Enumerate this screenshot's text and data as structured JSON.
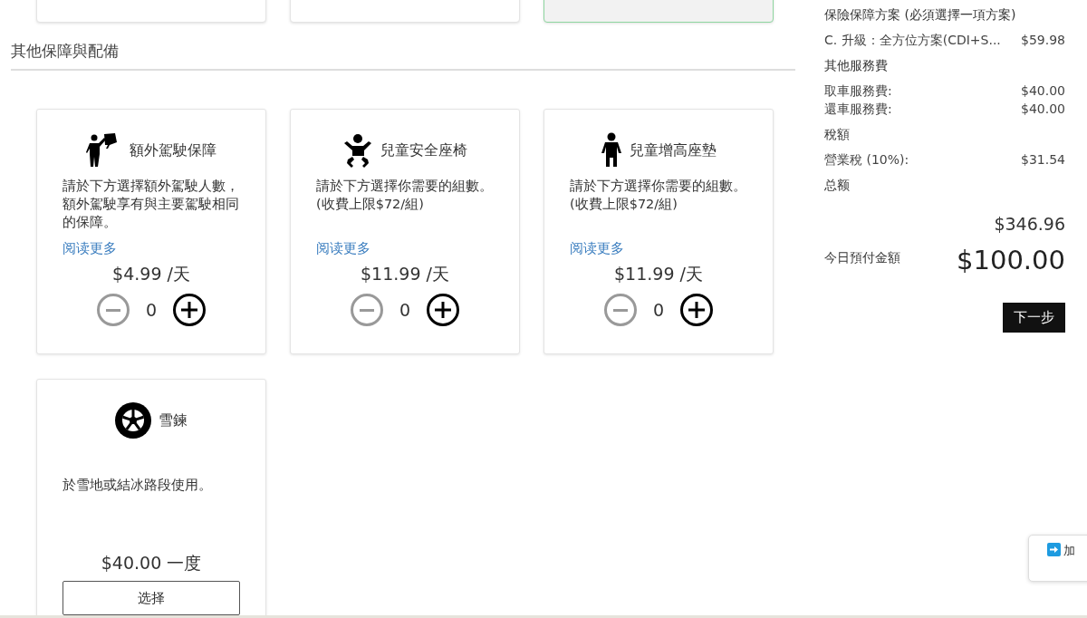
{
  "plan_cards": [
    {
      "selected": false
    },
    {
      "selected": false
    },
    {
      "selected": true
    }
  ],
  "section_title": "其他保障與配備",
  "extras": [
    {
      "kind": "counter",
      "title": "額外駕駛保障",
      "description": "請於下方選擇額外駕駛人數，額外駕駛享有與主要駕駛相同的保障。",
      "read_more": "阅读更多",
      "price": "$4.99 /天",
      "count": "0",
      "decrease_disabled": true
    },
    {
      "kind": "counter",
      "title": "兒童安全座椅",
      "description": "請於下方選擇你需要的組數。\n(收費上限$72/組)",
      "read_more": "阅读更多",
      "price": "$11.99 /天",
      "count": "0",
      "decrease_disabled": true
    },
    {
      "kind": "counter",
      "title": "兒童增高座墊",
      "description": "請於下方選擇你需要的組數。\n(收費上限$72/組)",
      "read_more": "阅读更多",
      "price": "$11.99 /天",
      "count": "0",
      "decrease_disabled": true
    },
    {
      "kind": "select",
      "title": "雪鍊",
      "description": "於雪地或結冰路段使用。",
      "price": "$40.00 一度",
      "button": "选择"
    }
  ],
  "summary": [
    {
      "kind": "heading",
      "label": "保險保障方案 (必須選擇一項方案)"
    },
    {
      "kind": "line",
      "label": "C. 升級：全方位方案(CDI+S...",
      "value": "$59.98"
    },
    {
      "kind": "heading",
      "label": "其他服務費"
    },
    {
      "kind": "tight",
      "label": "取車服務費:",
      "value": "$40.00"
    },
    {
      "kind": "line",
      "label": "還車服務費:",
      "value": "$40.00"
    },
    {
      "kind": "heading",
      "label": "稅額"
    },
    {
      "kind": "line",
      "label": "營業稅 (10%):",
      "value": "$31.54"
    },
    {
      "kind": "heading",
      "label": "总额"
    }
  ],
  "total": "$346.96",
  "due_today": {
    "label": "今日預付金額",
    "value": "$100.00"
  },
  "next_button": "下一步",
  "floating_widget": {
    "label": "加"
  }
}
